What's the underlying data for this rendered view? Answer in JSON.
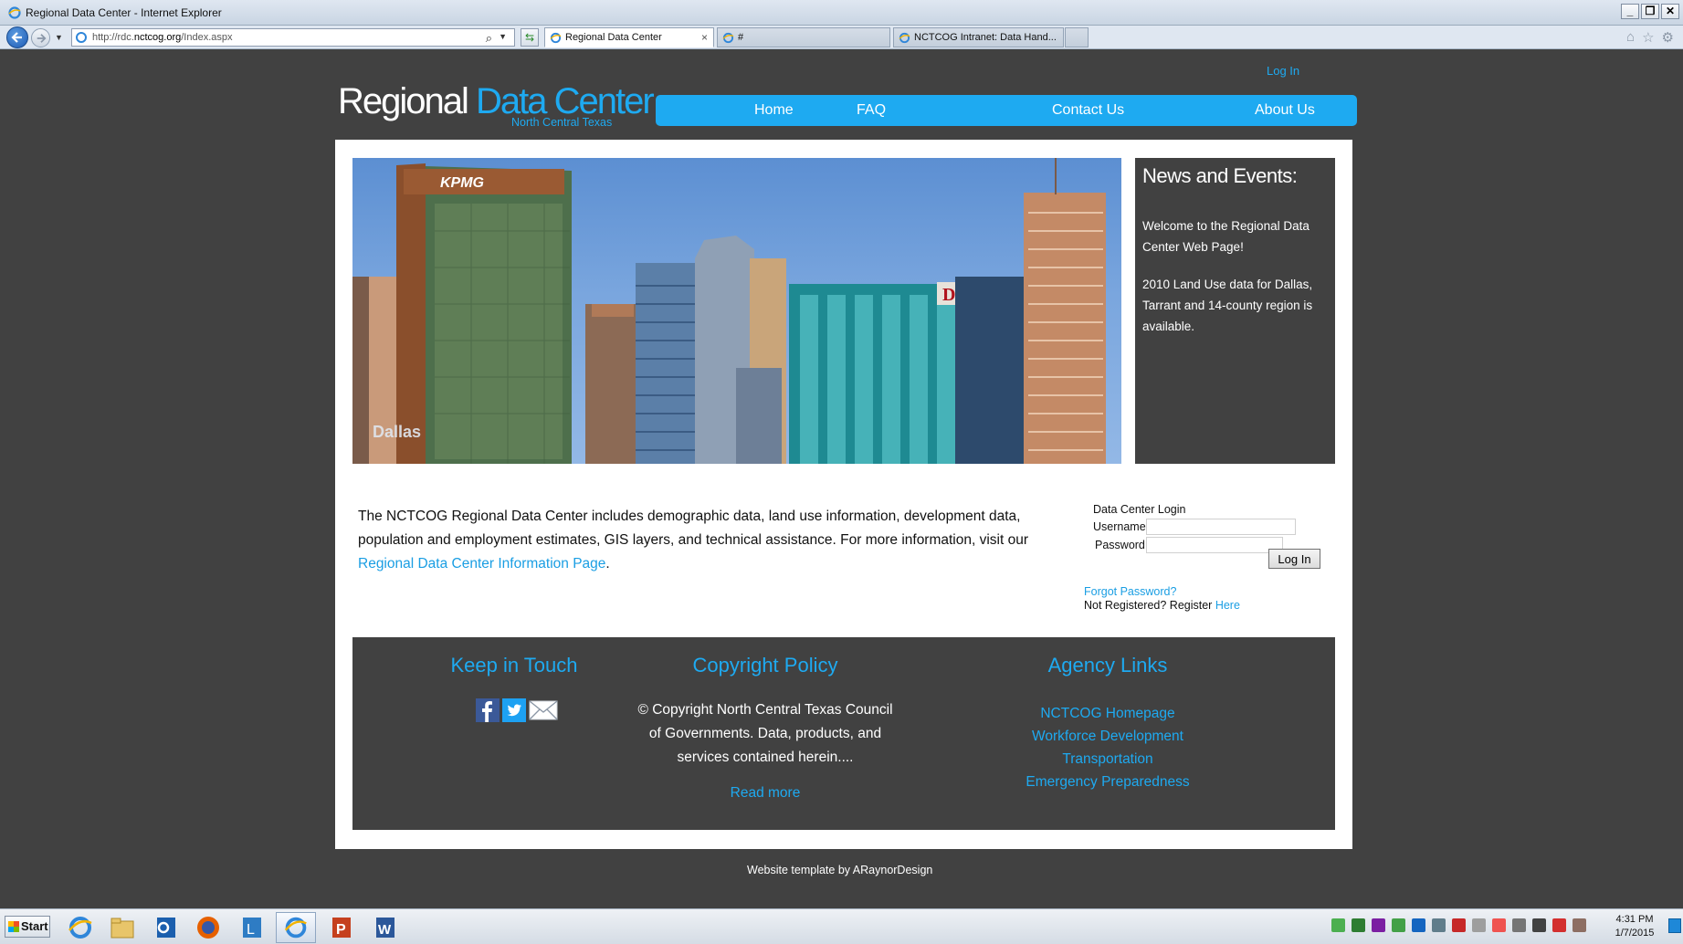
{
  "window": {
    "title": "Regional Data Center - Internet Explorer",
    "controls": {
      "minimize": "_",
      "restore": "❐",
      "close": "✕"
    }
  },
  "browser": {
    "url_prefix": "http://rdc.",
    "url_domain": "nctcog.org",
    "url_path": "/Index.aspx",
    "tabs": [
      {
        "label": "Regional Data Center",
        "active": true,
        "close": "×"
      },
      {
        "label": "#",
        "active": false
      },
      {
        "label": "NCTCOG Intranet: Data Hand...",
        "active": false
      }
    ],
    "tool_icons": [
      "home-icon",
      "favorites-star-icon",
      "settings-gear-icon"
    ]
  },
  "page": {
    "brand": {
      "logo_white": "Regional ",
      "logo_blue": "Data Center",
      "subtitle": "North Central Texas"
    },
    "top_login": "Log In",
    "nav": [
      {
        "label": "Home"
      },
      {
        "label": "FAQ"
      },
      {
        "label": "Contact Us"
      },
      {
        "label": "About Us"
      }
    ],
    "hero": {
      "caption": "Dallas",
      "sign_kpmg": "KPMG",
      "sign_d": "D"
    },
    "news": {
      "heading": "News and Events:",
      "items": [
        "Welcome to the Regional Data Center Web Page!",
        "2010 Land Use data for Dallas, Tarrant and 14-county region is available."
      ]
    },
    "intro": {
      "text": "The NCTCOG Regional Data Center includes demographic data, land use information, development data, population and employment estimates, GIS layers, and technical assistance. For more information, visit our ",
      "link": "Regional Data Center Information Page",
      "end": "."
    },
    "login": {
      "title": "Data Center Login",
      "username_label": "Username:",
      "password_label": "Password:",
      "username_value": "",
      "password_value": "",
      "button": "Log In",
      "forgot": "Forgot Password?",
      "not_registered": "Not Registered? Register ",
      "register_link": "Here"
    },
    "footer": {
      "keep_in_touch": {
        "heading": "Keep in Touch",
        "icons": [
          "facebook-icon",
          "twitter-icon",
          "email-icon"
        ]
      },
      "copyright": {
        "heading": "Copyright Policy",
        "text": "© Copyright North Central Texas Council of Governments. Data, products, and services contained herein....",
        "read_more": "Read more"
      },
      "agency": {
        "heading": "Agency Links",
        "links": [
          "NCTCOG Homepage",
          "Workforce Development",
          "Transportation",
          "Emergency Preparedness"
        ]
      }
    },
    "credit": "Website template by ARaynorDesign"
  },
  "taskbar": {
    "start": "Start",
    "apps": [
      "internet-explorer-icon",
      "file-explorer-icon",
      "outlook-icon",
      "firefox-icon",
      "lync-icon",
      "internet-explorer-active-icon",
      "powerpoint-icon",
      "word-icon"
    ],
    "clock_time": "4:31 PM",
    "clock_date": "1/7/2015"
  },
  "colors": {
    "accent": "#1eaaf1",
    "page_bg": "#414141",
    "content_bg": "#ffffff"
  }
}
